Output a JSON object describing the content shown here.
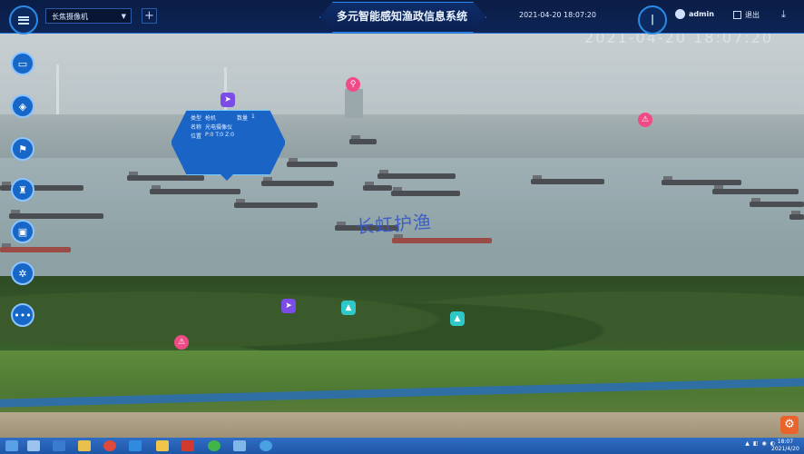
{
  "app": {
    "title": "多元智能感知渔政信息系统",
    "datetime": "2021-04-20 18:07:20"
  },
  "camera_select": {
    "value": "长焦摄像机"
  },
  "user": {
    "name": "admin"
  },
  "logout": {
    "label": "退出"
  },
  "feed": {
    "overlay_timestamp": "2021-04-20 18:07:20",
    "watermark": "长虹护渔"
  },
  "popup": {
    "type_label": "类型",
    "type_value": "枪机",
    "count_label": "数量",
    "count_value": "1",
    "name_label": "名称",
    "name_value": "光电摄像仪",
    "pos_label": "位置",
    "pos_value": "P:0  T:0  Z:0"
  },
  "left_toolbar": [
    {
      "icon": "folder-icon"
    },
    {
      "icon": "layers-icon"
    },
    {
      "icon": "flag-icon"
    },
    {
      "icon": "alarm-icon"
    },
    {
      "icon": "save-icon"
    },
    {
      "icon": "settings-icon"
    },
    {
      "icon": "more-icon"
    }
  ],
  "taskbar": {
    "clock_time": "18:07",
    "clock_date": "2021/4/20"
  },
  "colors": {
    "accent": "#1767c9",
    "topbar": "#0a1d46",
    "marker_purple": "#7b4de6",
    "marker_pink": "#f04b86",
    "marker_cyan": "#2ec8c8"
  }
}
